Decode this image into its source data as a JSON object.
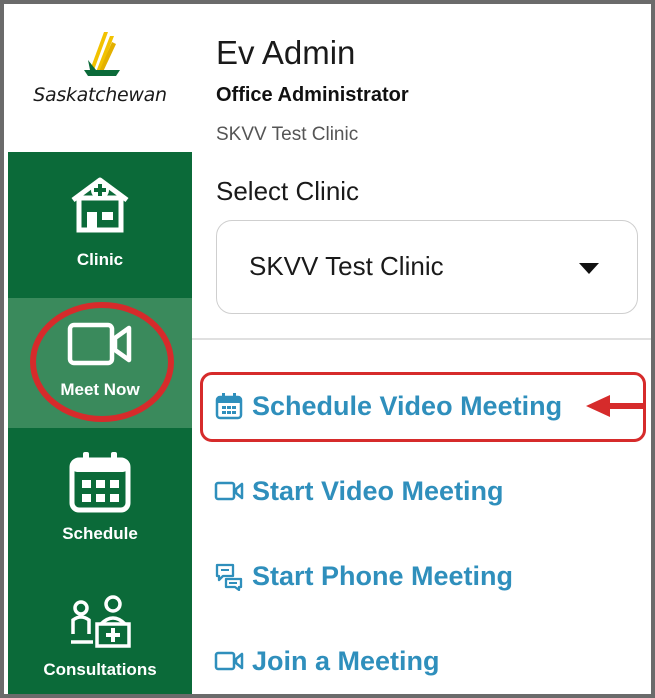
{
  "brand": {
    "name": "Saskatchewan",
    "accent": "#0b6a39",
    "active": "#3a8a5c",
    "logo_gold": "#f2c200"
  },
  "sidebar": {
    "items": [
      {
        "label": "Clinic",
        "icon": "clinic-building-icon"
      },
      {
        "label": "Meet Now",
        "icon": "video-camera-icon",
        "active": true
      },
      {
        "label": "Schedule",
        "icon": "calendar-icon"
      },
      {
        "label": "Consultations",
        "icon": "consultation-icon"
      }
    ]
  },
  "user": {
    "name": "Ev Admin",
    "role": "Office Administrator",
    "clinic": "SKVV Test Clinic"
  },
  "clinic_select": {
    "label": "Select Clinic",
    "value": "SKVV Test Clinic"
  },
  "actions": [
    {
      "label": "Schedule Video Meeting",
      "icon": "calendar-icon"
    },
    {
      "label": "Start Video Meeting",
      "icon": "video-camera-icon"
    },
    {
      "label": "Start Phone Meeting",
      "icon": "chat-bubbles-icon"
    },
    {
      "label": "Join a Meeting",
      "icon": "video-camera-icon"
    }
  ],
  "annotations": {
    "color": "#d62b2b"
  }
}
